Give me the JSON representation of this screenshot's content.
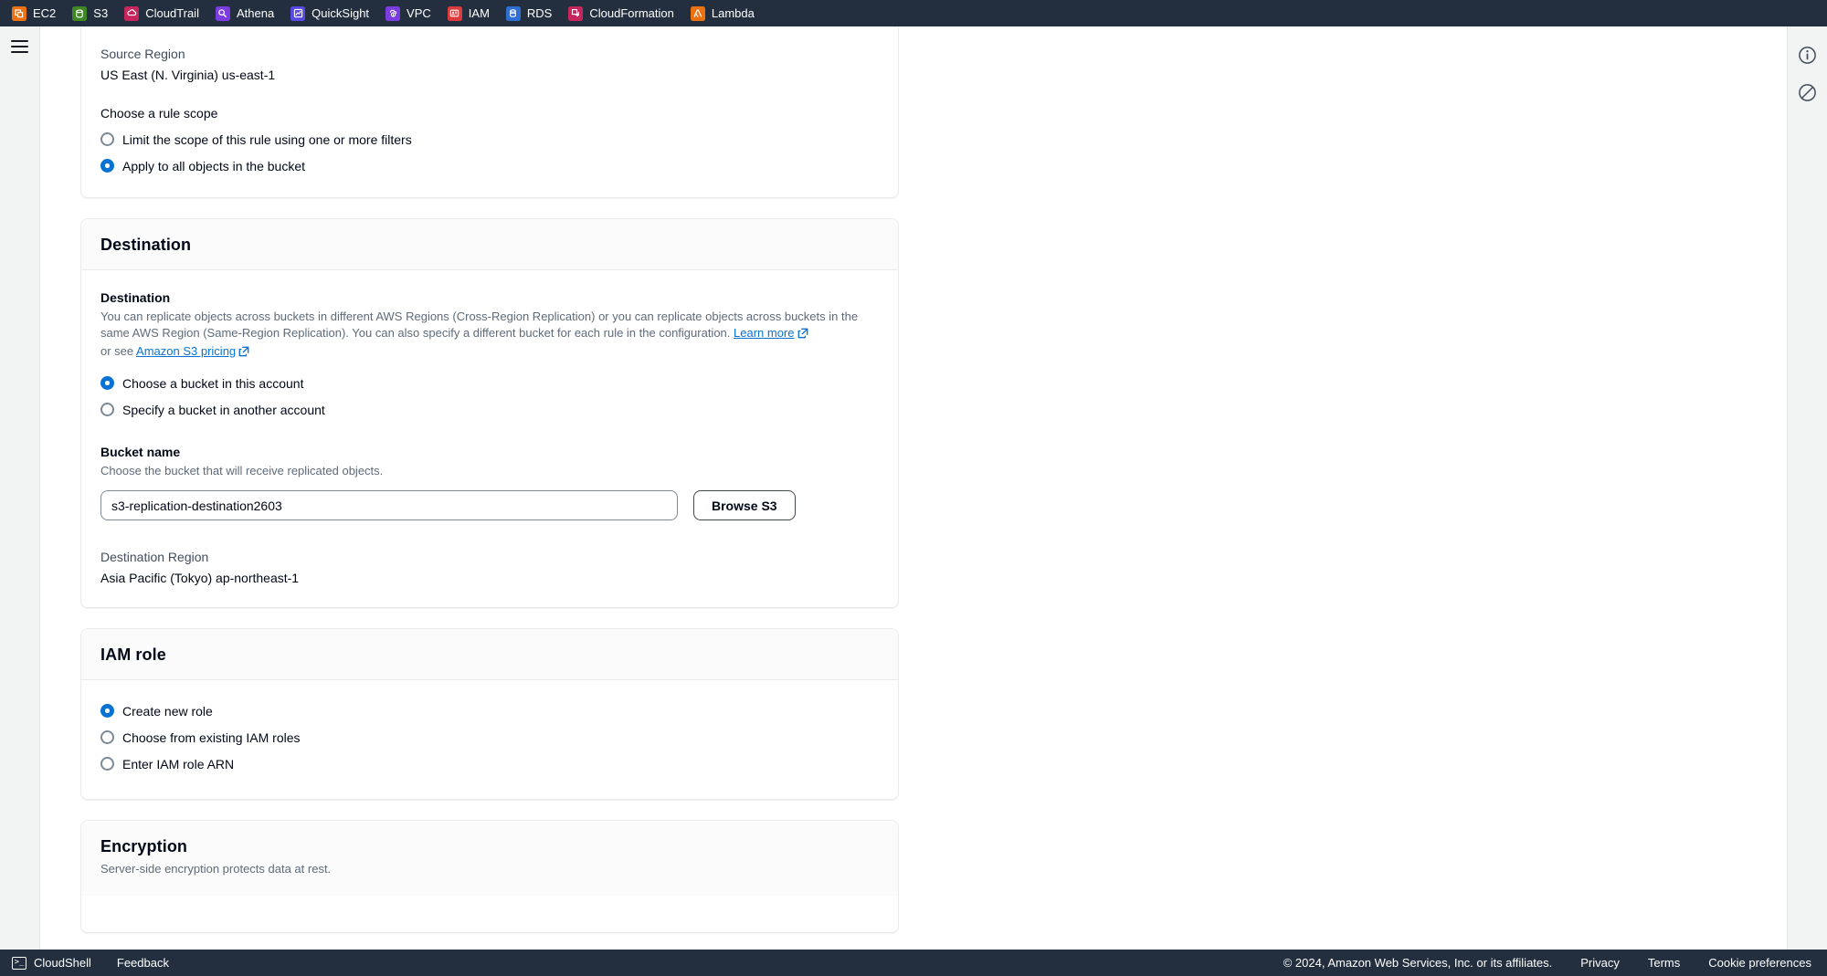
{
  "topnav": {
    "services": [
      {
        "label": "EC2",
        "icon": "ec2-icon",
        "color": "#ec7211"
      },
      {
        "label": "S3",
        "icon": "s3-icon",
        "color": "#3f8624"
      },
      {
        "label": "CloudTrail",
        "icon": "cloudtrail-icon",
        "color": "#c7255d"
      },
      {
        "label": "Athena",
        "icon": "athena-icon",
        "color": "#7b3ce0"
      },
      {
        "label": "QuickSight",
        "icon": "quicksight-icon",
        "color": "#5a4ae3"
      },
      {
        "label": "VPC",
        "icon": "vpc-icon",
        "color": "#7b3ce0"
      },
      {
        "label": "IAM",
        "icon": "iam-icon",
        "color": "#dd3c3c"
      },
      {
        "label": "RDS",
        "icon": "rds-icon",
        "color": "#2f6fd4"
      },
      {
        "label": "CloudFormation",
        "icon": "cloudformation-icon",
        "color": "#c7255d"
      },
      {
        "label": "Lambda",
        "icon": "lambda-icon",
        "color": "#ec7211"
      }
    ]
  },
  "rails": {
    "menu_icon": "hamburger-menu-icon",
    "info_icon": "info-icon",
    "notifications_icon": "no-entry-icon"
  },
  "source": {
    "region_label": "Source Region",
    "region_value": "US East (N. Virginia) us-east-1",
    "scope_label": "Choose a rule scope",
    "scope_options": [
      {
        "label": "Limit the scope of this rule using one or more filters",
        "selected": false
      },
      {
        "label": "Apply to all objects in the bucket",
        "selected": true
      }
    ]
  },
  "destination": {
    "card_title": "Destination",
    "section_label": "Destination",
    "description_part1": "You can replicate objects across buckets in different AWS Regions (Cross-Region Replication) or you can replicate objects across buckets in the same AWS Region (Same-Region Replication). You can also specify a different bucket for each rule in the configuration.",
    "learn_more_label": "Learn more",
    "description_part2": "or see",
    "pricing_link_label": "Amazon S3 pricing",
    "options": [
      {
        "label": "Choose a bucket in this account",
        "selected": true
      },
      {
        "label": "Specify a bucket in another account",
        "selected": false
      }
    ],
    "bucket_name_label": "Bucket name",
    "bucket_name_desc": "Choose the bucket that will receive replicated objects.",
    "bucket_name_value": "s3-replication-destination2603",
    "bucket_name_placeholder": "Bucket name",
    "browse_button_label": "Browse S3",
    "dest_region_label": "Destination Region",
    "dest_region_value": "Asia Pacific (Tokyo) ap-northeast-1"
  },
  "iam_role": {
    "card_title": "IAM role",
    "options": [
      {
        "label": "Create new role",
        "selected": true
      },
      {
        "label": "Choose from existing IAM roles",
        "selected": false
      },
      {
        "label": "Enter IAM role ARN",
        "selected": false
      }
    ]
  },
  "encryption": {
    "card_title": "Encryption",
    "description": "Server-side encryption protects data at rest."
  },
  "footer": {
    "cloudshell_label": "CloudShell",
    "cloudshell_icon": "terminal-icon",
    "feedback_label": "Feedback",
    "copyright": "© 2024, Amazon Web Services, Inc. or its affiliates.",
    "privacy_label": "Privacy",
    "terms_label": "Terms",
    "cookie_label": "Cookie preferences"
  },
  "colors": {
    "accent": "#0972d3",
    "nav_bg": "#232f3e",
    "rail_bg": "#f2f3f3",
    "text": "#000716",
    "muted": "#5f6b7a"
  }
}
